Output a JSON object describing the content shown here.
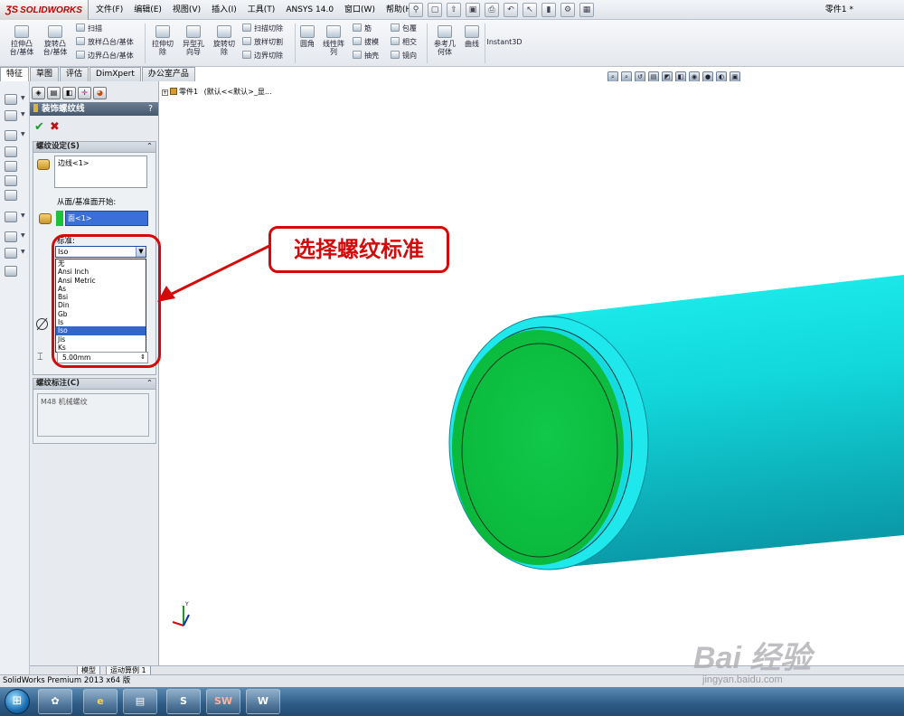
{
  "app": {
    "brand": "SOLIDWORKS",
    "document_title": "零件1 *"
  },
  "menu": [
    "文件(F)",
    "编辑(E)",
    "视图(V)",
    "插入(I)",
    "工具(T)",
    "ANSYS 14.0",
    "窗口(W)",
    "帮助(H)"
  ],
  "commands": {
    "extrude_boss": "拉伸凸\n台/基体",
    "revolve_boss": "旋转凸\n台/基体",
    "sweep": "扫描",
    "loft_boss": "放样凸台/基体",
    "boundary_boss": "边界凸台/基体",
    "extrude_cut": "拉伸切\n除",
    "hole_wizard": "异型孔\n向导",
    "revolve_cut": "旋转切\n除",
    "sweep_cut": "扫描切除",
    "loft_cut": "放样切割",
    "boundary_cut": "边界切除",
    "fillet": "圆角",
    "linear_pattern": "线性阵\n列",
    "rib": "筋",
    "draft": "拔模",
    "shell": "抽壳",
    "wrap": "包覆",
    "intersect": "相交",
    "mirror": "镜向",
    "ref_geometry": "参考几\n何体",
    "curves": "曲线",
    "instant3d": "Instant3D"
  },
  "tabs": [
    "特征",
    "草图",
    "评估",
    "DimXpert",
    "办公室产品"
  ],
  "property_manager": {
    "title": "装饰螺纹线",
    "help": "?",
    "thread_settings_title": "螺纹设定(S)",
    "edge_value": "边线<1>",
    "from_label": "从面/基准面开始:",
    "face_value": "面<1>",
    "standard_label": "标准:",
    "standard_selected": "Iso",
    "standard_options": [
      "无",
      "Ansi Inch",
      "Ansi Metric",
      "As",
      "Bsi",
      "Din",
      "Gb",
      "Is",
      "Iso",
      "Jis",
      "Ks"
    ],
    "depth_value": "5.00mm",
    "callout_title": "螺纹标注(C)",
    "callout_value": "M48 机械螺纹"
  },
  "tree": {
    "root_label": "零件1",
    "config_label": "(默认<<默认>_显..."
  },
  "bottom_tabs": [
    "模型",
    "运动算例 1"
  ],
  "status": "SolidWorks Premium 2013 x64 版",
  "annotation": {
    "callout_text": "选择螺纹标准",
    "color": "#d40a0a"
  },
  "colors": {
    "cylinder_body": "#10dde0",
    "end_face": "#0bc23e",
    "pm_header": "#45586d"
  },
  "watermark": {
    "logo": "Bai 经验",
    "url": "jingyan.baidu.com"
  }
}
